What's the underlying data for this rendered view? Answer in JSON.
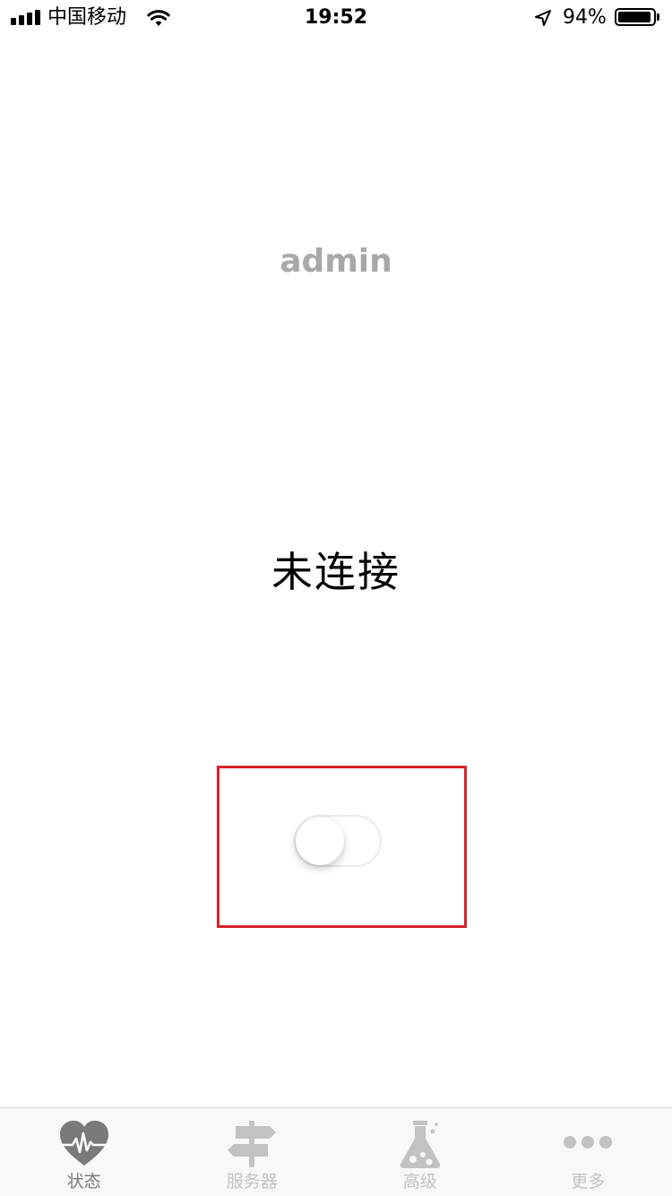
{
  "status_bar": {
    "carrier": "中国移动",
    "time": "19:52",
    "battery_percent": "94%",
    "battery_level": 0.94,
    "icons": [
      "signal-icon",
      "wifi-icon",
      "location-arrow-icon",
      "battery-icon"
    ]
  },
  "main": {
    "username": "admin",
    "connection_status": "未连接",
    "toggle": {
      "state": "off",
      "highlight_color": "#d8232a"
    }
  },
  "tab_bar": {
    "active_index": 0,
    "items": [
      {
        "label": "状态",
        "icon": "heart-pulse-icon"
      },
      {
        "label": "服务器",
        "icon": "signpost-icon"
      },
      {
        "label": "高级",
        "icon": "flask-icon"
      },
      {
        "label": "更多",
        "icon": "more-dots-icon"
      }
    ]
  },
  "colors": {
    "tab_active": "#7a7a7a",
    "tab_inactive": "#c2c2c2",
    "username": "#a8a8a8"
  }
}
